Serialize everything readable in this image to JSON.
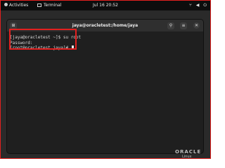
{
  "topbar": {
    "activities": "Activities",
    "app": "Terminal",
    "clock": "Jul 16  20:52"
  },
  "window": {
    "title": "jaya@oracletest:/home/jaya",
    "terminal_lines": [
      "[jaya@oracletest ~]$ su root",
      "Password:",
      "[root@oracletest jaya]# "
    ]
  },
  "desktop": {
    "logo_brand": "ORACLE",
    "logo_sub": "Linux"
  },
  "colors": {
    "annotation": "#e3201f",
    "topbar_bg": "#0d0d0d",
    "terminal_bg": "#1f1f1f"
  }
}
